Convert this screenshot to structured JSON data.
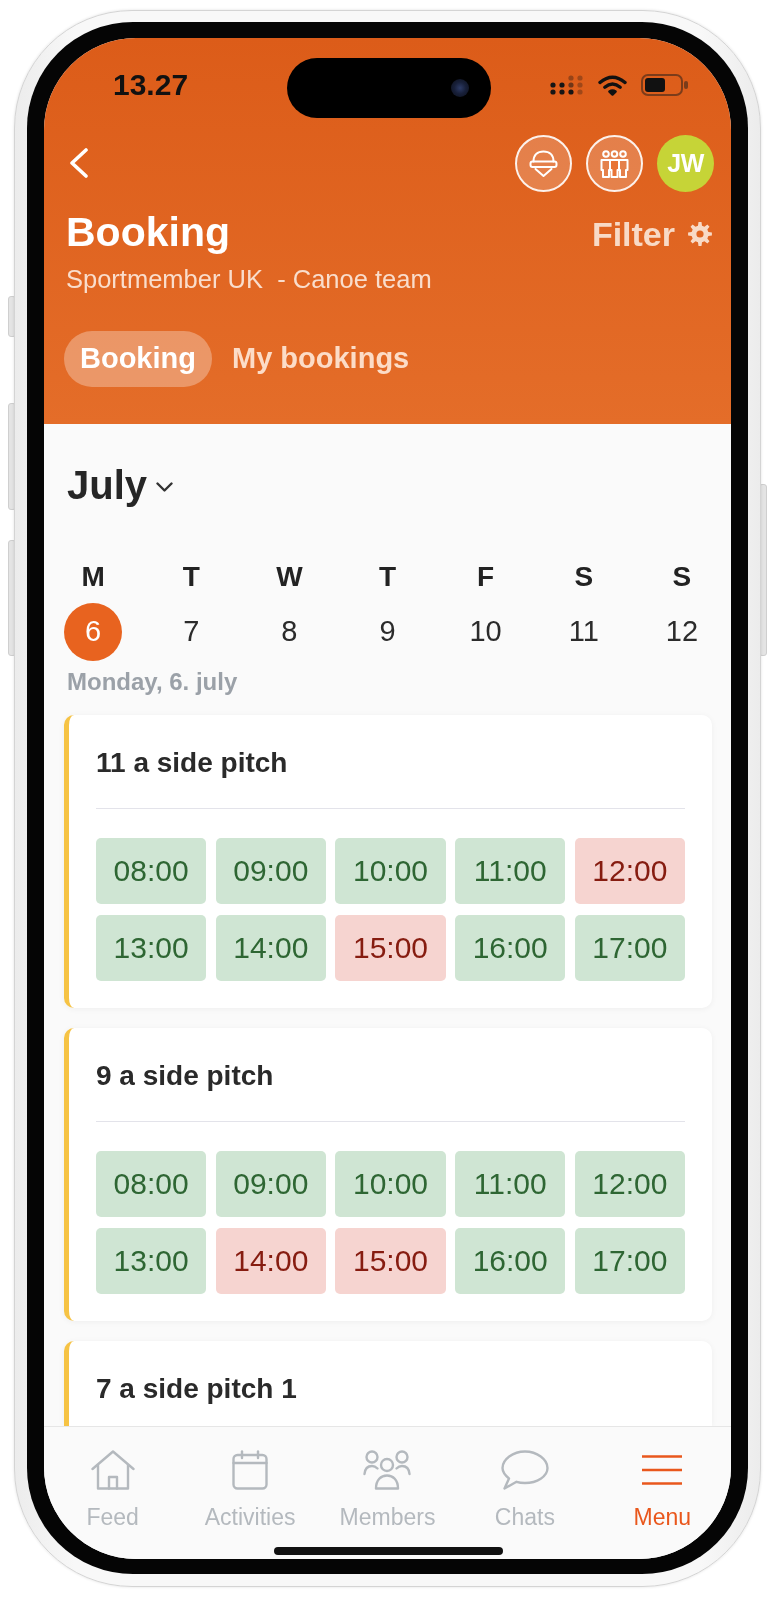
{
  "status_bar": {
    "time": "13.27"
  },
  "header": {
    "avatar_initials": "JW",
    "title": "Booking",
    "filter_label": "Filter",
    "subtitle": "Sportmember UK  - Canoe team"
  },
  "tabs": [
    {
      "label": "Booking",
      "selected": true
    },
    {
      "label": "My bookings",
      "selected": false
    }
  ],
  "calendar": {
    "month": "July",
    "days": [
      {
        "weekday": "M",
        "date": "6",
        "selected": true
      },
      {
        "weekday": "T",
        "date": "7",
        "selected": false
      },
      {
        "weekday": "W",
        "date": "8",
        "selected": false
      },
      {
        "weekday": "T",
        "date": "9",
        "selected": false
      },
      {
        "weekday": "F",
        "date": "10",
        "selected": false
      },
      {
        "weekday": "S",
        "date": "11",
        "selected": false
      },
      {
        "weekday": "S",
        "date": "12",
        "selected": false
      }
    ],
    "selected_date_label": "Monday, 6. july"
  },
  "resources": [
    {
      "name": "11 a side pitch",
      "slots": [
        {
          "time": "08:00",
          "available": true
        },
        {
          "time": "09:00",
          "available": true
        },
        {
          "time": "10:00",
          "available": true
        },
        {
          "time": "11:00",
          "available": true
        },
        {
          "time": "12:00",
          "available": false
        },
        {
          "time": "13:00",
          "available": true
        },
        {
          "time": "14:00",
          "available": true
        },
        {
          "time": "15:00",
          "available": false
        },
        {
          "time": "16:00",
          "available": true
        },
        {
          "time": "17:00",
          "available": true
        }
      ]
    },
    {
      "name": "9 a side pitch",
      "slots": [
        {
          "time": "08:00",
          "available": true
        },
        {
          "time": "09:00",
          "available": true
        },
        {
          "time": "10:00",
          "available": true
        },
        {
          "time": "11:00",
          "available": true
        },
        {
          "time": "12:00",
          "available": true
        },
        {
          "time": "13:00",
          "available": true
        },
        {
          "time": "14:00",
          "available": false
        },
        {
          "time": "15:00",
          "available": false
        },
        {
          "time": "16:00",
          "available": true
        },
        {
          "time": "17:00",
          "available": true
        }
      ]
    },
    {
      "name": "7 a side pitch 1"
    }
  ],
  "bottom_nav": [
    {
      "kind": "home",
      "label": "Feed",
      "selected": false
    },
    {
      "kind": "calendar",
      "label": "Activities",
      "selected": false
    },
    {
      "kind": "people",
      "label": "Members",
      "selected": false
    },
    {
      "kind": "chat",
      "label": "Chats",
      "selected": false
    },
    {
      "kind": "menu",
      "label": "Menu",
      "selected": true
    }
  ]
}
